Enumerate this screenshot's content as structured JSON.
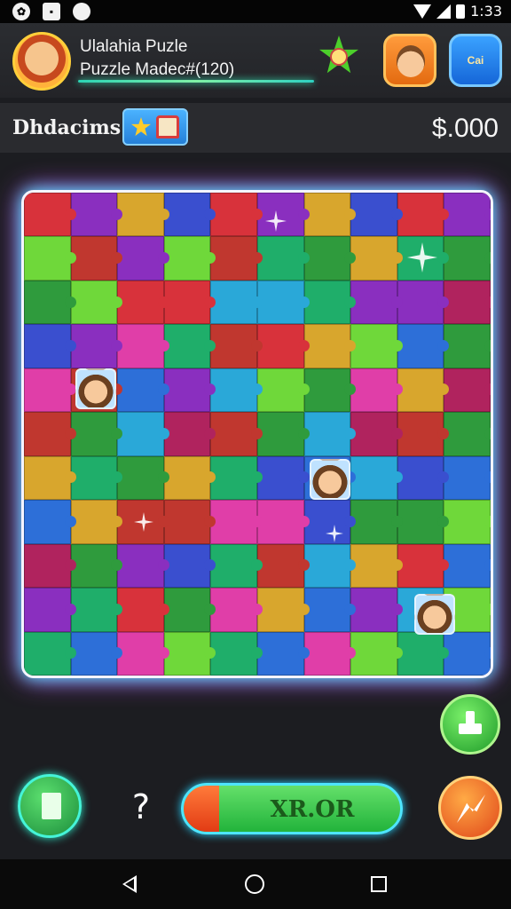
{
  "status": {
    "time": "1:33"
  },
  "header": {
    "title": "Ulalahia Puzle",
    "subtitle": "Puzzle Madec#(120)"
  },
  "infobar": {
    "label": "Dhdacims",
    "money": "$.000"
  },
  "shop_button": {
    "label": "Cai"
  },
  "board": {
    "columns": 10,
    "rows": 11,
    "palette": [
      "#d8323b",
      "#2d6fd8",
      "#2f9b3d",
      "#8a2fbf",
      "#e03ea8",
      "#2aa8d8",
      "#d8a62d",
      "#6fd83a",
      "#b0235e",
      "#3a4fcf",
      "#1fae6a",
      "#c0372f"
    ]
  },
  "controls": {
    "main_button_label": "XR.OR",
    "undo_symbol": "?"
  }
}
